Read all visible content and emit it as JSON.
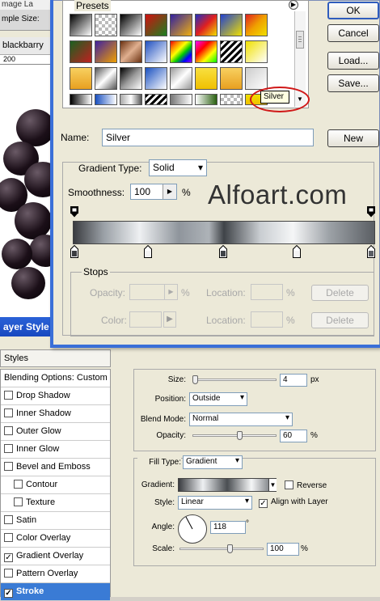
{
  "background_app": {
    "menu_text": "mage   La",
    "options_text": "mple Size:",
    "doc_tab": "blackbarry",
    "ruler_mark": "200"
  },
  "gradient_editor": {
    "presets_label": "Presets",
    "tooltip": "Silver",
    "buttons": {
      "ok": "OK",
      "cancel": "Cancel",
      "load": "Load...",
      "save": "Save...",
      "new": "New"
    },
    "name_label": "Name:",
    "name_value": "Silver",
    "gradient_type_label": "Gradient Type:",
    "gradient_type_value": "Solid",
    "smoothness_label": "Smoothness:",
    "smoothness_value": "100",
    "smoothness_unit": "%",
    "watermark": "Alfoart.com",
    "stops": {
      "label": "Stops",
      "opacity_label": "Opacity:",
      "color_label": "Color:",
      "location_label": "Location:",
      "unit": "%",
      "delete_label": "Delete"
    }
  },
  "layer_style": {
    "title": "ayer Style",
    "styles_header": "Styles",
    "items": [
      {
        "label": "Blending Options: Custom",
        "checkbox": false,
        "checked": false,
        "sub": false,
        "selected": false
      },
      {
        "label": "Drop Shadow",
        "checkbox": true,
        "checked": false,
        "sub": false,
        "selected": false
      },
      {
        "label": "Inner Shadow",
        "checkbox": true,
        "checked": false,
        "sub": false,
        "selected": false
      },
      {
        "label": "Outer Glow",
        "checkbox": true,
        "checked": false,
        "sub": false,
        "selected": false
      },
      {
        "label": "Inner Glow",
        "checkbox": true,
        "checked": false,
        "sub": false,
        "selected": false
      },
      {
        "label": "Bevel and Emboss",
        "checkbox": true,
        "checked": false,
        "sub": false,
        "selected": false
      },
      {
        "label": "Contour",
        "checkbox": true,
        "checked": false,
        "sub": true,
        "selected": false
      },
      {
        "label": "Texture",
        "checkbox": true,
        "checked": false,
        "sub": true,
        "selected": false
      },
      {
        "label": "Satin",
        "checkbox": true,
        "checked": false,
        "sub": false,
        "selected": false
      },
      {
        "label": "Color Overlay",
        "checkbox": true,
        "checked": false,
        "sub": false,
        "selected": false
      },
      {
        "label": "Gradient Overlay",
        "checkbox": true,
        "checked": true,
        "sub": false,
        "selected": false
      },
      {
        "label": "Pattern Overlay",
        "checkbox": true,
        "checked": false,
        "sub": false,
        "selected": false
      },
      {
        "label": "Stroke",
        "checkbox": true,
        "checked": true,
        "sub": false,
        "selected": true
      }
    ],
    "stroke": {
      "size_label": "Size:",
      "size_value": "4",
      "size_unit": "px",
      "position_label": "Position:",
      "position_value": "Outside",
      "blend_label": "Blend Mode:",
      "blend_value": "Normal",
      "opacity_label": "Opacity:",
      "opacity_value": "60",
      "opacity_unit": "%",
      "fill_type_label": "Fill Type:",
      "fill_type_value": "Gradient",
      "gradient_label": "Gradient:",
      "reverse_label": "Reverse",
      "style_label": "Style:",
      "style_value": "Linear",
      "align_label": "Align with Layer",
      "angle_label": "Angle:",
      "angle_value": "118",
      "angle_unit": "°",
      "scale_label": "Scale:",
      "scale_value": "100",
      "scale_unit": "%"
    }
  }
}
